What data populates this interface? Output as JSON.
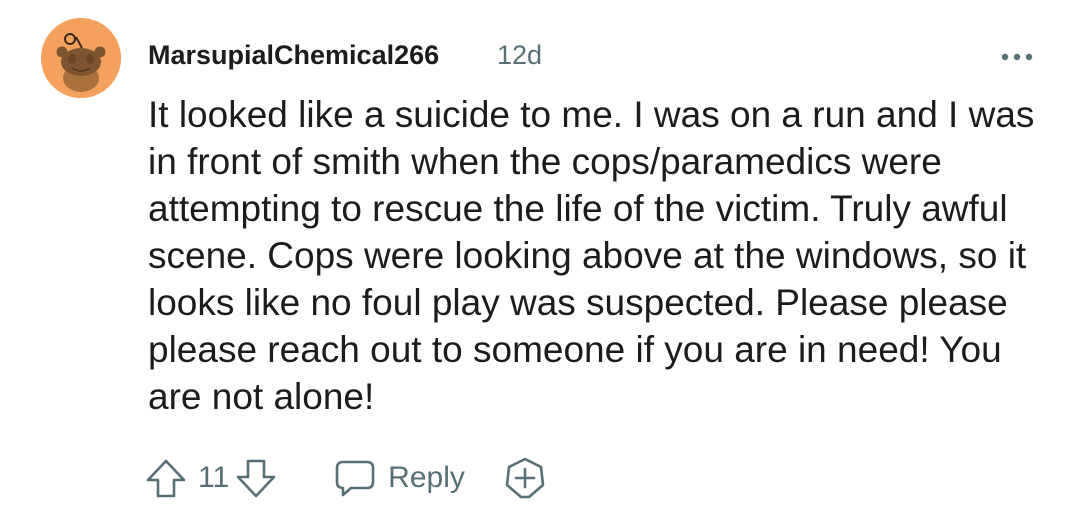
{
  "comment": {
    "username": "MarsupialChemical266",
    "age": "12d",
    "body": "It looked like a suicide to me. I was on a run and I was in front of smith when the cops/paramedics were attempting to rescue the life of the victim. Truly awful scene. Cops were looking above at the windows, so it looks like no foul play was suspected. Please please please reach out to someone if you are in need! You are not alone!",
    "vote_count": "11",
    "reply_label": "Reply"
  },
  "icons": {
    "avatar": "snoo-avatar",
    "more": "more-options-icon",
    "upvote": "upvote-arrow-icon",
    "downvote": "downvote-arrow-icon",
    "reply": "speech-bubble-icon",
    "award": "award-plus-icon"
  },
  "colors": {
    "avatar_background": "#f4a15d",
    "text": "#1c1c1c",
    "muted": "#576f76"
  }
}
